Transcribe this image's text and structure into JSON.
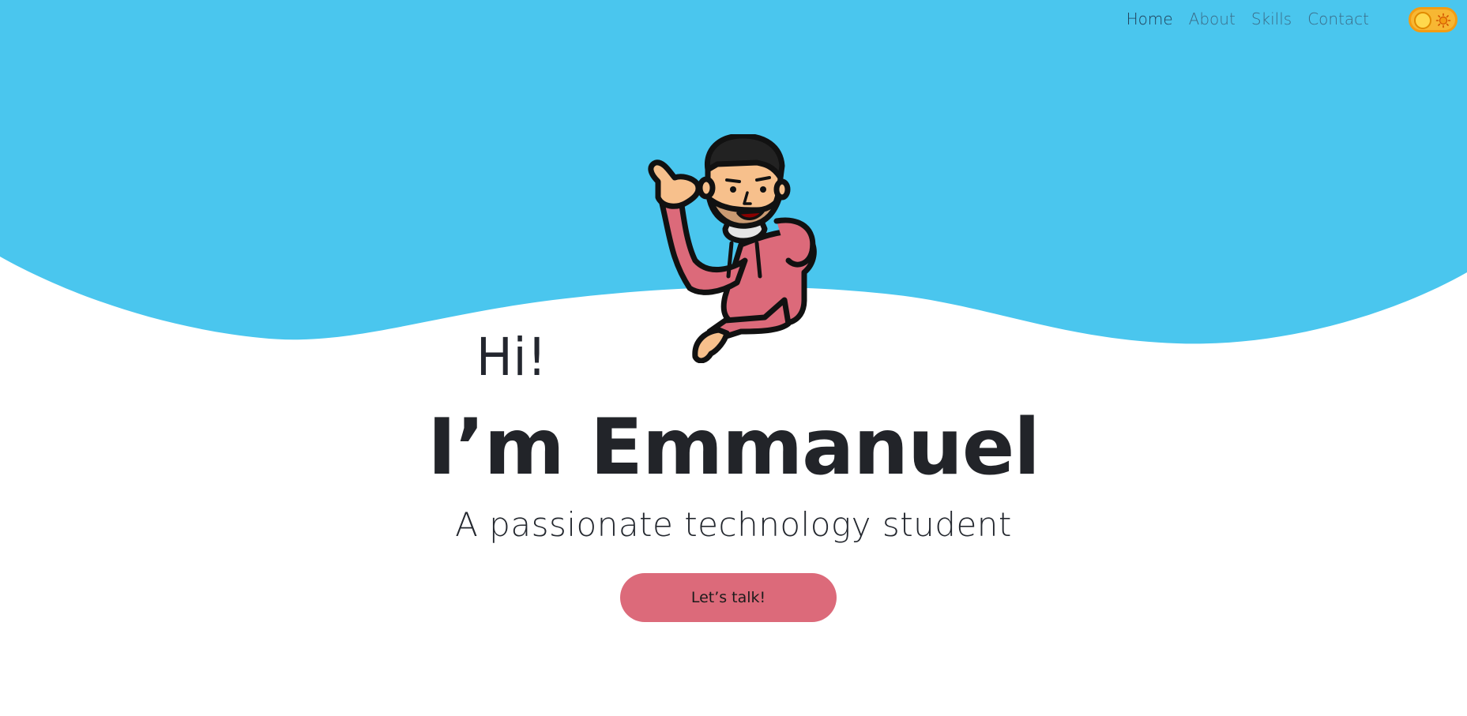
{
  "colors": {
    "hero_background": "#4ac6ee",
    "page_background": "#ffffff",
    "nav_text": "#3a6a86",
    "nav_active": "#1f3c55",
    "cta_background": "#dc6a7a",
    "toggle_background": "#f7b733",
    "heading_text": "#222429"
  },
  "nav": {
    "items": [
      {
        "label": "Home",
        "active": true
      },
      {
        "label": "About",
        "active": false
      },
      {
        "label": "Skills",
        "active": false
      },
      {
        "label": "Contact",
        "active": false
      }
    ],
    "theme_toggle": {
      "icon": "sun-icon",
      "state": "light"
    }
  },
  "hero": {
    "avatar_icon": "waving-man-avatar",
    "greeting": "Hi!",
    "name": "I’m Emmanuel",
    "tagline": "A passionate technology student",
    "cta_label": "Let’s talk!"
  }
}
